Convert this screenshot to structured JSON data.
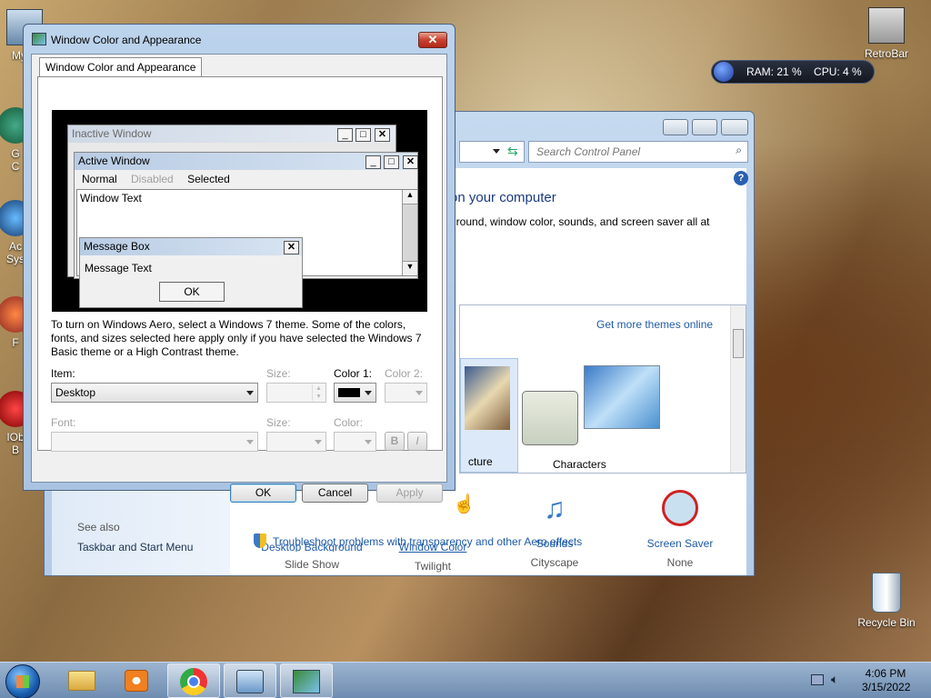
{
  "desktop": {
    "icons": [
      {
        "name": "my-computer",
        "label": "My C"
      },
      {
        "name": "g",
        "label": "G\nC"
      },
      {
        "name": "ac-sys",
        "label": "Ac\nSys"
      },
      {
        "name": "f",
        "label": "F"
      },
      {
        "name": "iob",
        "label": "IOb\nB"
      },
      {
        "name": "retrobar",
        "label": "RetroBar"
      },
      {
        "name": "recycle-bin",
        "label": "Recycle Bin"
      }
    ],
    "gadget": {
      "ram": "RAM: 21 %",
      "cpu": "CPU: 4 %"
    }
  },
  "control_panel": {
    "search_placeholder": "Search Control Panel",
    "heading": "on your computer",
    "subheading": "ground, window color, sounds, and screen saver all at",
    "get_more_themes": "Get more themes online",
    "theme_partial_label": "cture",
    "theme_characters_label": "Characters",
    "items": [
      {
        "title": "Desktop Background",
        "sub": "Slide Show"
      },
      {
        "title": "Window Color",
        "sub": "Twilight"
      },
      {
        "title": "Sounds",
        "sub": "Cityscape"
      },
      {
        "title": "Screen Saver",
        "sub": "None"
      }
    ],
    "see_also": "See also",
    "taskbar_link": "Taskbar and Start Menu",
    "troubleshoot": "Troubleshoot problems with transparency and other Aero effects"
  },
  "dialog": {
    "title": "Window Color and Appearance",
    "tab": "Window Color and Appearance",
    "preview": {
      "inactive": "Inactive Window",
      "active": "Active Window",
      "menu_normal": "Normal",
      "menu_disabled": "Disabled",
      "menu_selected": "Selected",
      "window_text": "Window Text",
      "msgbox_title": "Message Box",
      "msgbox_text": "Message Text",
      "msgbox_ok": "OK"
    },
    "info": "To turn on Windows Aero, select a Windows 7 theme.  Some of the colors, fonts, and sizes selected here apply only if you have selected the Windows 7 Basic theme or a High Contrast theme.",
    "item_label": "Item:",
    "item_value": "Desktop",
    "size_label": "Size:",
    "color1_label": "Color 1:",
    "color1_value": "#000000",
    "color2_label": "Color 2:",
    "font_label": "Font:",
    "font_size_label": "Size:",
    "font_color_label": "Color:",
    "bold": "B",
    "italic": "I",
    "ok": "OK",
    "cancel": "Cancel",
    "apply": "Apply"
  },
  "taskbar": {
    "time": "4:06 PM",
    "date": "3/15/2022",
    "buttons": [
      "explorer",
      "media-player",
      "chrome",
      "control-panel",
      "window-color"
    ]
  }
}
